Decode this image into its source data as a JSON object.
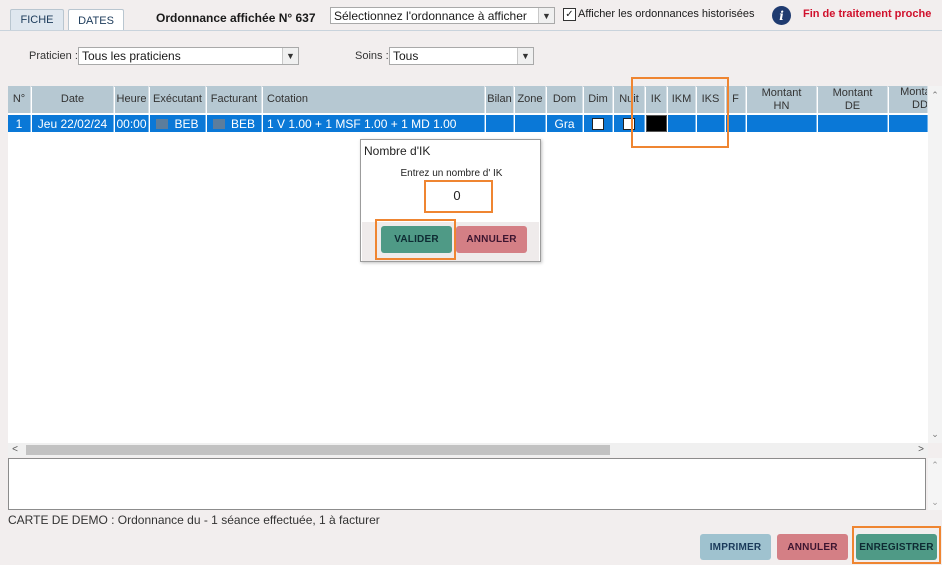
{
  "tabs": [
    {
      "label": "FICHE"
    },
    {
      "label": "DATES"
    }
  ],
  "header": {
    "title": "Ordonnance affichée N° 637",
    "ordonnance_select": "Sélectionnez l'ordonnance à afficher",
    "historised_checkbox_label": "Afficher les ordonnances historisées",
    "historised_checked": true,
    "info_icon": "info-icon",
    "alert_text": "Fin de traitement proche"
  },
  "filters": {
    "praticien_label": "Praticien :",
    "praticien_value": "Tous les praticiens",
    "soins_label": "Soins :",
    "soins_value": "Tous"
  },
  "table": {
    "columns": [
      "N°",
      "Date",
      "Heure",
      "Exécutant",
      "Facturant",
      "Cotation",
      "Bilan",
      "Zone",
      "Dom",
      "Dim",
      "Nuit",
      "IK",
      "IKM",
      "IKS",
      "F",
      "Montant HN",
      "Montant DE",
      "Montant DD"
    ],
    "rows": [
      {
        "num": "1",
        "date": "Jeu 22/02/24",
        "heure": "00:00",
        "executant": "BEB",
        "facturant": "BEB",
        "cotation": "1 V 1.00 + 1 MSF 1.00 + 1 MD 1.00",
        "bilan": "",
        "zone": "",
        "dom": "Gra",
        "dim": false,
        "nuit": false
      }
    ]
  },
  "notes": "",
  "status_text": "CARTE DE DEMO : Ordonnance du    - 1 séance effectuée, 1 à facturer",
  "footer": {
    "print_label": "IMPRIMER",
    "cancel_label": "ANNULER",
    "save_label": "ENREGISTRER"
  },
  "dialog": {
    "title": "Nombre d'IK",
    "prompt": "Entrez un nombre d' IK",
    "input_value": "0",
    "ok_label": "VALIDER",
    "cancel_label": "ANNULER"
  },
  "colors": {
    "selected_row": "#0a78d7",
    "header_bg": "#b6c8d2",
    "highlight": "#ef8531",
    "alert": "#d0102c",
    "save_button": "#4f9a86",
    "cancel_button": "#d47f85",
    "print_button": "#9fc2cf"
  }
}
